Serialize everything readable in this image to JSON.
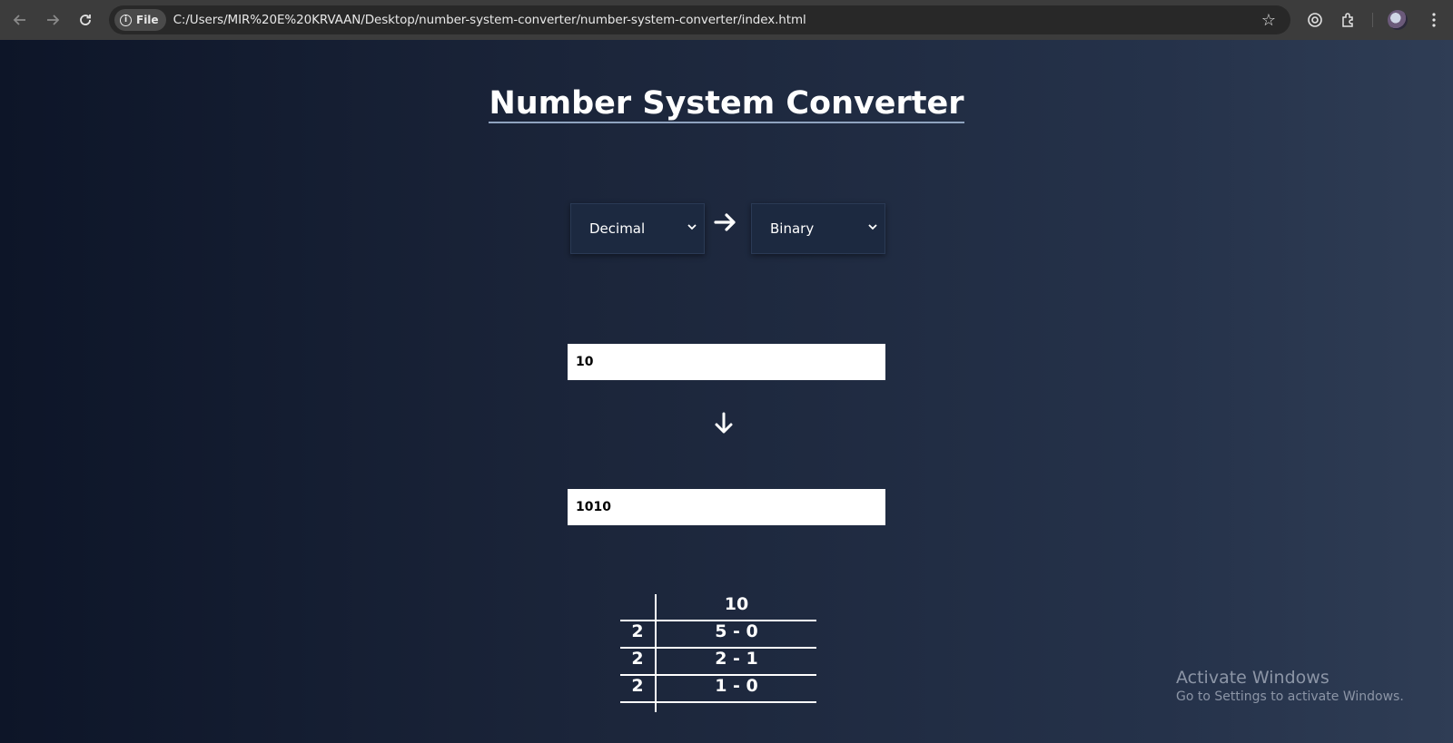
{
  "browser": {
    "file_chip_label": "File",
    "url": "C:/Users/MIR%20E%20KRVAAN/Desktop/number-system-converter/number-system-converter/index.html"
  },
  "page": {
    "title": "Number System Converter",
    "from_select": {
      "selected": "Decimal"
    },
    "to_select": {
      "selected": "Binary"
    },
    "input_value": "10",
    "output_value": "1010",
    "division_table": {
      "header_value": "10",
      "rows": [
        {
          "divisor": "2",
          "value": "5 - 0"
        },
        {
          "divisor": "2",
          "value": "2 - 1"
        },
        {
          "divisor": "2",
          "value": "1 - 0"
        }
      ]
    }
  },
  "watermark": {
    "line1": "Activate Windows",
    "line2": "Go to Settings to activate Windows."
  },
  "icons": {
    "back": "arrow-left-icon",
    "forward": "arrow-right-icon",
    "reload": "reload-icon",
    "info": "info-icon",
    "bookmark": "star-icon",
    "lens": "lens-icon",
    "extensions": "puzzle-icon",
    "menu": "kebab-menu-icon"
  }
}
